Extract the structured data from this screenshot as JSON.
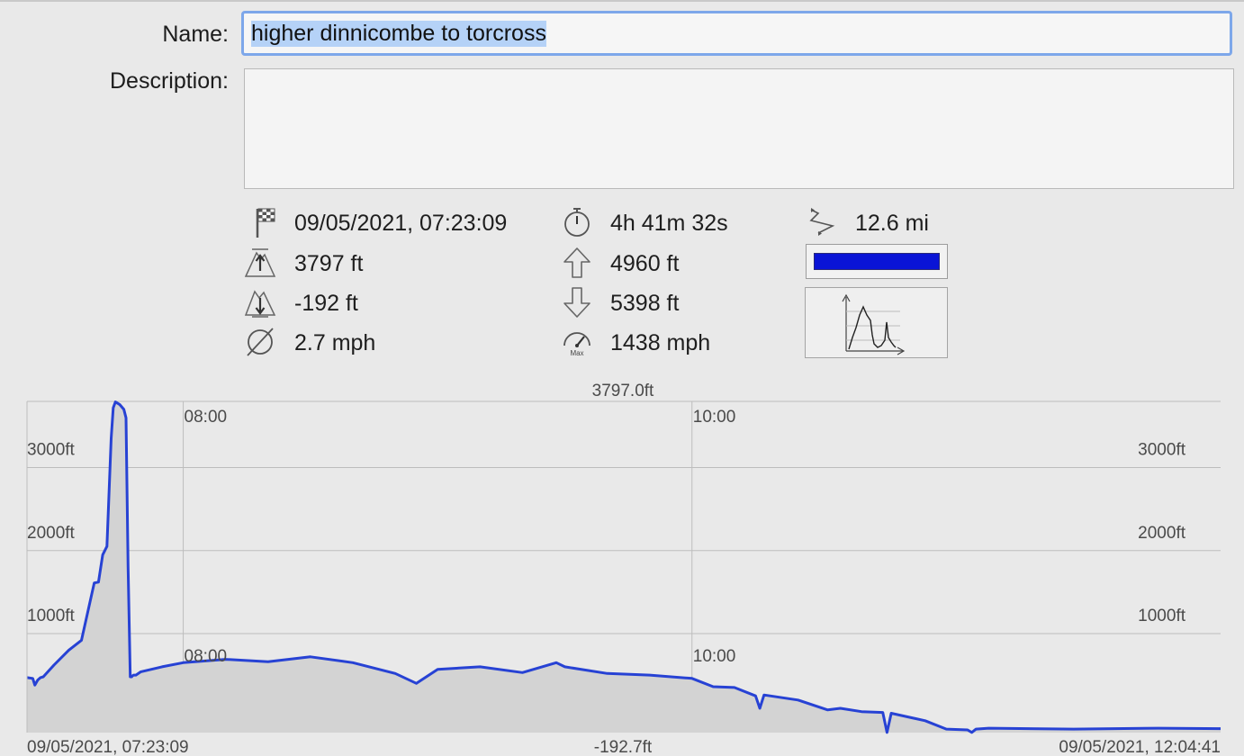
{
  "form": {
    "name_label": "Name:",
    "name_value": "higher dinnicombe to torcross",
    "description_label": "Description:",
    "description_value": ""
  },
  "stats": {
    "start": "09/05/2021, 07:23:09",
    "duration": "4h 41m 32s",
    "distance": "12.6 mi",
    "max_elevation": "3797 ft",
    "ascent": "4960 ft",
    "min_elevation": "-192 ft",
    "descent": "5398 ft",
    "avg_speed": "2.7 mph",
    "max_speed": "1438 mph",
    "max_badge": "Max",
    "track_color": "#0a14d6"
  },
  "icons": {
    "start": "checkered-flag-icon",
    "duration": "stopwatch-icon",
    "distance": "route-icon",
    "max_elevation": "mountain-up-icon",
    "ascent": "arrow-up-icon",
    "min_elevation": "mountain-down-icon",
    "descent": "arrow-down-icon",
    "avg_speed": "average-icon",
    "max_speed": "speedometer-icon",
    "profile": "elevation-profile-icon"
  },
  "chart_data": {
    "type": "area",
    "title": "3797.0ft",
    "x_start_label": "09/05/2021, 07:23:09",
    "x_end_label": "09/05/2021, 12:04:41",
    "bottom_center_label": "-192.7ft",
    "x_range": [
      "07:23:09",
      "12:04:41"
    ],
    "x_ticks": [
      "08:00",
      "10:00"
    ],
    "y_ticks": [
      "1000ft",
      "2000ft",
      "3000ft"
    ],
    "ylim": [
      -192.7,
      3797.0
    ],
    "grid": true,
    "line_color": "#2742d4",
    "fill_color": "#d3d3d3",
    "series": [
      {
        "x": [
          "07:23:09",
          "07:24:30",
          "07:25:00",
          "07:25:40",
          "07:26:20",
          "07:27:00",
          "07:29:30",
          "07:33:00",
          "07:36:00",
          "07:39:00",
          "07:40:00",
          "07:41:00",
          "07:42:00",
          "07:43:00",
          "07:43:30",
          "07:44:00",
          "07:45:00",
          "07:46:00",
          "07:46:30",
          "07:47:00",
          "07:47:30",
          "07:47:50",
          "07:48:00",
          "07:48:20",
          "07:48:40",
          "07:48:50",
          "07:50:00",
          "07:55:00",
          "08:00:00",
          "08:10:00",
          "08:20:00",
          "08:30:00",
          "08:40:00",
          "08:50:00",
          "08:55:00",
          "09:00:00",
          "09:10:00",
          "09:20:00",
          "09:28:00",
          "09:30:00",
          "09:40:00",
          "09:50:00",
          "10:00:00",
          "10:05:00",
          "10:10:00",
          "10:15:00",
          "10:16:00",
          "10:17:00",
          "10:25:00",
          "10:32:00",
          "10:35:00",
          "10:40:00",
          "10:45:00",
          "10:46:00",
          "10:47:00",
          "10:55:00",
          "11:00:00",
          "11:05:00",
          "11:06:00",
          "11:07:00",
          "11:10:00",
          "11:30:00",
          "11:50:00",
          "12:04:41"
        ],
        "y": [
          470,
          460,
          380,
          440,
          470,
          480,
          620,
          800,
          920,
          1610,
          1620,
          1950,
          2050,
          3350,
          3720,
          3790,
          3760,
          3700,
          3600,
          1800,
          480,
          480,
          490,
          500,
          500,
          500,
          540,
          600,
          650,
          690,
          660,
          720,
          650,
          520,
          400,
          570,
          600,
          530,
          650,
          600,
          520,
          500,
          460,
          360,
          350,
          250,
          100,
          260,
          200,
          80,
          100,
          60,
          50,
          -190,
          40,
          -50,
          -150,
          -160,
          -190,
          -150,
          -140,
          -150,
          -140,
          -145
        ]
      }
    ]
  }
}
